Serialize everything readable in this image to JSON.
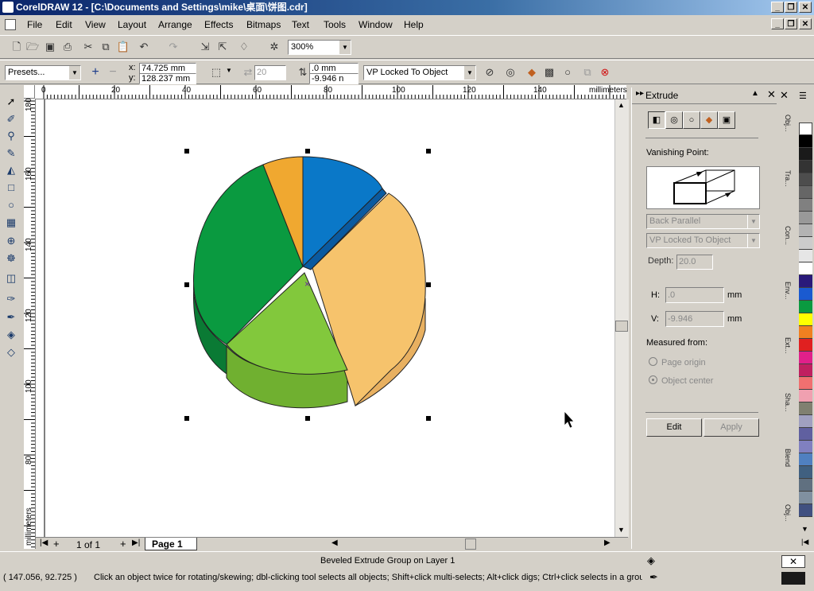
{
  "window": {
    "title": "CorelDRAW 12 - [C:\\Documents and Settings\\mike\\桌面\\饼图.cdr]"
  },
  "menu": [
    "File",
    "Edit",
    "View",
    "Layout",
    "Arrange",
    "Effects",
    "Bitmaps",
    "Text",
    "Tools",
    "Window",
    "Help"
  ],
  "toolbar": {
    "zoom": "300%"
  },
  "propbar": {
    "presets": "Presets...",
    "x": "74.725 mm",
    "y": "128.237 mm",
    "depth_spin": "20",
    "vp_x": ".0 mm",
    "vp_y": "-9.946 n",
    "vp_mode": "VP Locked To Object"
  },
  "rulers": {
    "unit": "millimeters",
    "h_ticks": [
      "0",
      "20",
      "40",
      "60",
      "80",
      "100",
      "120",
      "140"
    ],
    "v_ticks": [
      "180",
      "160",
      "140",
      "120",
      "100",
      "80"
    ],
    "v_unit": "millimeters"
  },
  "pages": {
    "count": "1 of 1",
    "tab": "Page 1"
  },
  "pie": {
    "slices": [
      {
        "name": "blue",
        "color": "#0a78c8"
      },
      {
        "name": "light-orange",
        "color": "#f6c36c"
      },
      {
        "name": "light-green",
        "color": "#82c83c"
      },
      {
        "name": "dark-green",
        "color": "#0a9a40"
      },
      {
        "name": "orange",
        "color": "#f0a830"
      }
    ]
  },
  "docker": {
    "title": "Extrude",
    "vanishing_label": "Vanishing Point:",
    "type_select": "Back Parallel",
    "vp_select": "VP Locked To Object",
    "depth_label": "Depth:",
    "depth_value": "20.0",
    "h_label": "H:",
    "h_value": ".0",
    "h_unit": "mm",
    "v_label": "V:",
    "v_value": "-9.946",
    "v_unit": "mm",
    "measured_label": "Measured from:",
    "radio_page": "Page origin",
    "radio_object": "Object center",
    "edit_btn": "Edit",
    "apply_btn": "Apply"
  },
  "tabs": [
    "Obj...",
    "Tra...",
    "Con...",
    "Env...",
    "Ext...",
    "Sha...",
    "Blend",
    "Obj..."
  ],
  "palette": [
    "#ffffff",
    "#000000",
    "#1a1a1a",
    "#333333",
    "#4d4d4d",
    "#666666",
    "#808080",
    "#999999",
    "#b3b3b3",
    "#cccccc",
    "#e6e6e6",
    "#ffffff",
    "#2a1a7a",
    "#1a5ad0",
    "#0a9a40",
    "#ffff00",
    "#f08020",
    "#e02020",
    "#e0208a",
    "#c02060",
    "#f07070",
    "#f0a0b0",
    "#808070",
    "#a0a0c0",
    "#6060a0",
    "#8080c0",
    "#5080c0",
    "#406080",
    "#607080",
    "#8090a0",
    "#405080"
  ],
  "status": {
    "object_info": "Beveled Extrude Group on Layer 1",
    "coords": "( 147.056, 92.725 )",
    "hint": "Click an object twice for rotating/skewing; dbl-clicking tool selects all objects; Shift+click multi-selects; Alt+click digs; Ctrl+click selects in a group"
  }
}
